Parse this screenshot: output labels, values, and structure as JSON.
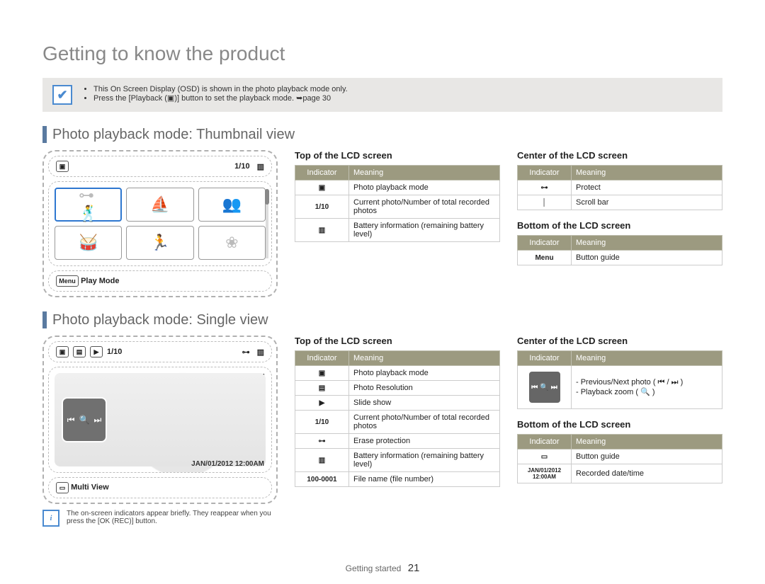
{
  "page_title": "Getting to know the product",
  "note": {
    "items": [
      "This On Screen Display (OSD) is shown in the photo playback mode only.",
      "Press the [Playback (▣)] button to set the playback mode. ➥page 30"
    ]
  },
  "section1": {
    "heading": "Photo playback mode: Thumbnail view",
    "lcd": {
      "counter": "1/10",
      "bottom_label": "Play Mode",
      "menu_label": "Menu"
    },
    "top_table": {
      "title": "Top of the LCD screen",
      "head": [
        "Indicator",
        "Meaning"
      ],
      "rows": [
        {
          "ind": "▣",
          "mean": "Photo playback mode"
        },
        {
          "ind": "1/10",
          "mean": "Current photo/Number of total recorded photos"
        },
        {
          "ind": "▥",
          "mean": "Battery information (remaining battery level)"
        }
      ]
    },
    "center_table": {
      "title": "Center of the LCD screen",
      "head": [
        "Indicator",
        "Meaning"
      ],
      "rows": [
        {
          "ind": "⊶",
          "mean": "Protect"
        },
        {
          "ind": "│",
          "mean": "Scroll bar"
        }
      ]
    },
    "bottom_table": {
      "title": "Bottom of the LCD screen",
      "head": [
        "Indicator",
        "Meaning"
      ],
      "rows": [
        {
          "ind": "Menu",
          "mean": "Button guide"
        }
      ]
    }
  },
  "section2": {
    "heading": "Photo playback mode: Single view",
    "lcd": {
      "counter": "1/10",
      "file_no": "100-0001",
      "datetime": "JAN/01/2012 12:00AM",
      "bottom_label": "Multi View"
    },
    "info_note": "The on-screen indicators appear briefly. They reappear when you press the [OK (REC)] button.",
    "top_table": {
      "title": "Top of the LCD screen",
      "head": [
        "Indicator",
        "Meaning"
      ],
      "rows": [
        {
          "ind": "▣",
          "mean": "Photo playback mode"
        },
        {
          "ind": "▤",
          "mean": "Photo Resolution"
        },
        {
          "ind": "▶",
          "mean": "Slide show"
        },
        {
          "ind": "1/10",
          "mean": "Current photo/Number of total recorded photos"
        },
        {
          "ind": "⊶",
          "mean": "Erase protection"
        },
        {
          "ind": "▥",
          "mean": "Battery information (remaining battery level)"
        },
        {
          "ind": "100-0001",
          "mean": "File name (file number)"
        }
      ]
    },
    "center_table": {
      "title": "Center of the LCD screen",
      "head": [
        "Indicator",
        "Meaning"
      ],
      "rows": [
        {
          "ind": "◀◀ 🔍 ▶▶",
          "mean": "- Previous/Next photo ( ⏮ / ⏭ )\n- Playback zoom ( 🔍 )"
        }
      ]
    },
    "bottom_table": {
      "title": "Bottom of the LCD screen",
      "head": [
        "Indicator",
        "Meaning"
      ],
      "rows": [
        {
          "ind": "▭",
          "mean": "Button guide"
        },
        {
          "ind": "JAN/01/2012 12:00AM",
          "mean": "Recorded date/time"
        }
      ]
    }
  },
  "footer": {
    "section": "Getting started",
    "page": "21"
  }
}
